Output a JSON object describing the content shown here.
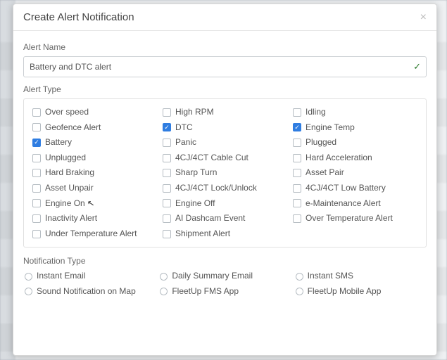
{
  "modal": {
    "title": "Create Alert Notification",
    "close_label": "×"
  },
  "alert_name": {
    "label": "Alert Name",
    "value": "Battery and DTC alert"
  },
  "alert_type": {
    "label": "Alert Type",
    "options": [
      {
        "label": "Over speed",
        "checked": false
      },
      {
        "label": "High RPM",
        "checked": false
      },
      {
        "label": "Idling",
        "checked": false
      },
      {
        "label": "Geofence Alert",
        "checked": false
      },
      {
        "label": "DTC",
        "checked": true
      },
      {
        "label": "Engine Temp",
        "checked": true
      },
      {
        "label": "Battery",
        "checked": true
      },
      {
        "label": "Panic",
        "checked": false
      },
      {
        "label": "Plugged",
        "checked": false
      },
      {
        "label": "Unplugged",
        "checked": false
      },
      {
        "label": "4CJ/4CT Cable Cut",
        "checked": false
      },
      {
        "label": "Hard Acceleration",
        "checked": false
      },
      {
        "label": "Hard Braking",
        "checked": false
      },
      {
        "label": "Sharp Turn",
        "checked": false
      },
      {
        "label": "Asset Pair",
        "checked": false
      },
      {
        "label": "Asset Unpair",
        "checked": false
      },
      {
        "label": "4CJ/4CT Lock/Unlock",
        "checked": false
      },
      {
        "label": "4CJ/4CT Low Battery",
        "checked": false
      },
      {
        "label": "Engine On",
        "checked": false
      },
      {
        "label": "Engine Off",
        "checked": false
      },
      {
        "label": "e-Maintenance Alert",
        "checked": false
      },
      {
        "label": "Inactivity Alert",
        "checked": false
      },
      {
        "label": "AI Dashcam Event",
        "checked": false
      },
      {
        "label": "Over Temperature Alert",
        "checked": false
      },
      {
        "label": "Under Temperature Alert",
        "checked": false
      },
      {
        "label": "Shipment Alert",
        "checked": false
      }
    ]
  },
  "notification_type": {
    "label": "Notification Type",
    "options": [
      {
        "label": "Instant Email"
      },
      {
        "label": "Daily Summary Email"
      },
      {
        "label": "Instant SMS"
      },
      {
        "label": "Sound Notification on Map"
      },
      {
        "label": "FleetUp FMS App"
      },
      {
        "label": "FleetUp Mobile App"
      }
    ]
  }
}
